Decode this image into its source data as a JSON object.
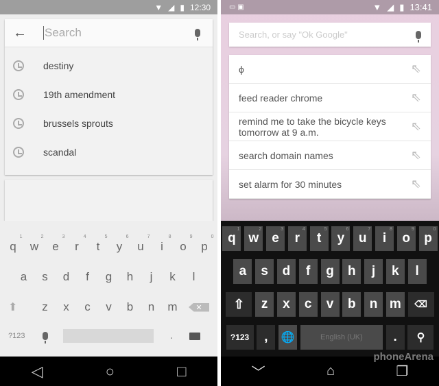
{
  "left": {
    "status": {
      "time": "12:30",
      "icons": [
        "wifi-icon",
        "signal-icon",
        "battery-icon"
      ]
    },
    "search": {
      "placeholder": "Search"
    },
    "history": [
      "destiny",
      "19th amendment",
      "brussels sprouts",
      "scandal"
    ],
    "keyboard": {
      "row1": [
        "q",
        "w",
        "e",
        "r",
        "t",
        "y",
        "u",
        "i",
        "o",
        "p"
      ],
      "row1_hints": [
        "1",
        "2",
        "3",
        "4",
        "5",
        "6",
        "7",
        "8",
        "9",
        "0"
      ],
      "row2": [
        "a",
        "s",
        "d",
        "f",
        "g",
        "h",
        "j",
        "k",
        "l"
      ],
      "row3": [
        "z",
        "x",
        "c",
        "v",
        "b",
        "n",
        "m"
      ],
      "symbols": "?123",
      "period": "."
    }
  },
  "right": {
    "status": {
      "time": "13:41",
      "icons": [
        "wifi-icon",
        "signal-icon",
        "battery-icon"
      ]
    },
    "search": {
      "placeholder": "Search, or say \"Ok Google\""
    },
    "suggestions": [
      "ϕ",
      "feed reader chrome",
      "remind me to take the bicycle keys tomorrow at 9 a.m.",
      "search domain names",
      "set alarm for 30 minutes"
    ],
    "keyboard": {
      "row1": [
        "q",
        "w",
        "e",
        "r",
        "t",
        "y",
        "u",
        "i",
        "o",
        "p"
      ],
      "row1_hints": [
        "1",
        "2",
        "3",
        "4",
        "5",
        "6",
        "7",
        "8",
        "9",
        "0"
      ],
      "row2": [
        "a",
        "s",
        "d",
        "f",
        "g",
        "h",
        "j",
        "k",
        "l"
      ],
      "row3": [
        "z",
        "x",
        "c",
        "v",
        "b",
        "n",
        "m"
      ],
      "symbols": "?123",
      "comma": ",",
      "space": "English (UK)",
      "period": "."
    },
    "watermark": "phoneArena"
  }
}
